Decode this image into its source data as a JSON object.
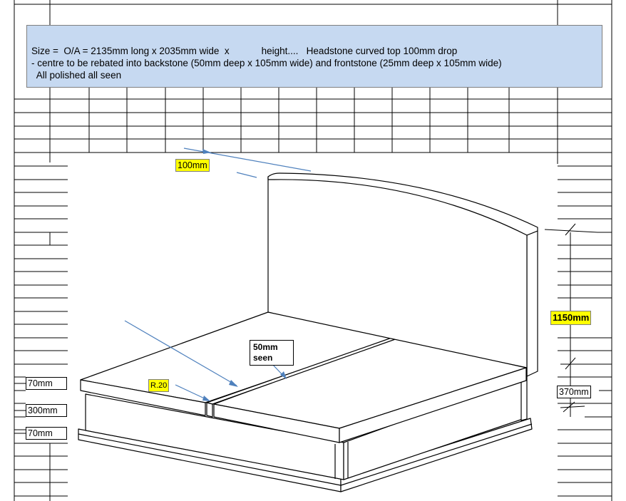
{
  "notes": {
    "line1": "Size =  O/A = 2135mm long x 2035mm wide  x            height....   Headstone curved top 100mm drop",
    "line2": "- centre to be rebated into backstone (50mm deep x 105mm wide) and frontstone (25mm deep x 105mm wide)",
    "line3": "  All polished all seen"
  },
  "dimensions": {
    "drop": "100mm",
    "radius": "R.20",
    "rebate_line1": "50mm",
    "rebate_line2": "seen",
    "height": "1150mm",
    "base_height": "370mm",
    "top_slab": "70mm",
    "base_mid": "300mm",
    "bottom_slab": "70mm"
  },
  "colors": {
    "note_fill": "#c6d9f1",
    "highlight": "#ffff00",
    "arrow": "#4f81bd",
    "grid": "#000000"
  }
}
